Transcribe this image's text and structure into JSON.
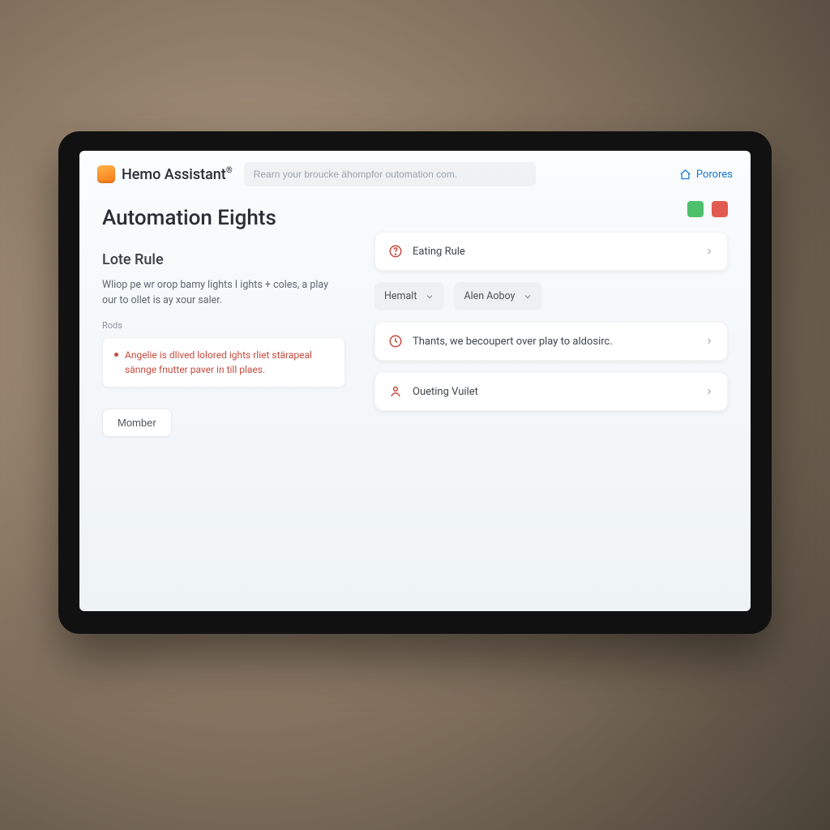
{
  "brand": {
    "name": "Hemo Assistant"
  },
  "search": {
    "placeholder": "Rearn your broucke ähompfor outomation com."
  },
  "nav": {
    "home_label": "Porores"
  },
  "page": {
    "title": "Automation Eights",
    "left": {
      "section_title": "Lote Rule",
      "description": "Wliop pe wr orop bamy lights I ights + coles, a play our to ollet is ay xour saler.",
      "minilabel": "Rods",
      "warning": "Angelie is dlived lolored ights rliet stärapeal sännge fnutter paver in till plaes.",
      "button_label": "Momber"
    },
    "right": {
      "status": {
        "green": "#4cc06b",
        "red": "#e25b52"
      },
      "cards": [
        {
          "icon": "question",
          "label": "Eating Rule"
        },
        {
          "icon": "clock",
          "label": "Thants, we becoupert over play to aldosirc."
        },
        {
          "icon": "person",
          "label": "Oueting Vuilet"
        }
      ],
      "selects": [
        {
          "label": "Hemalt"
        },
        {
          "label": "Alen Aoboy"
        }
      ]
    }
  }
}
